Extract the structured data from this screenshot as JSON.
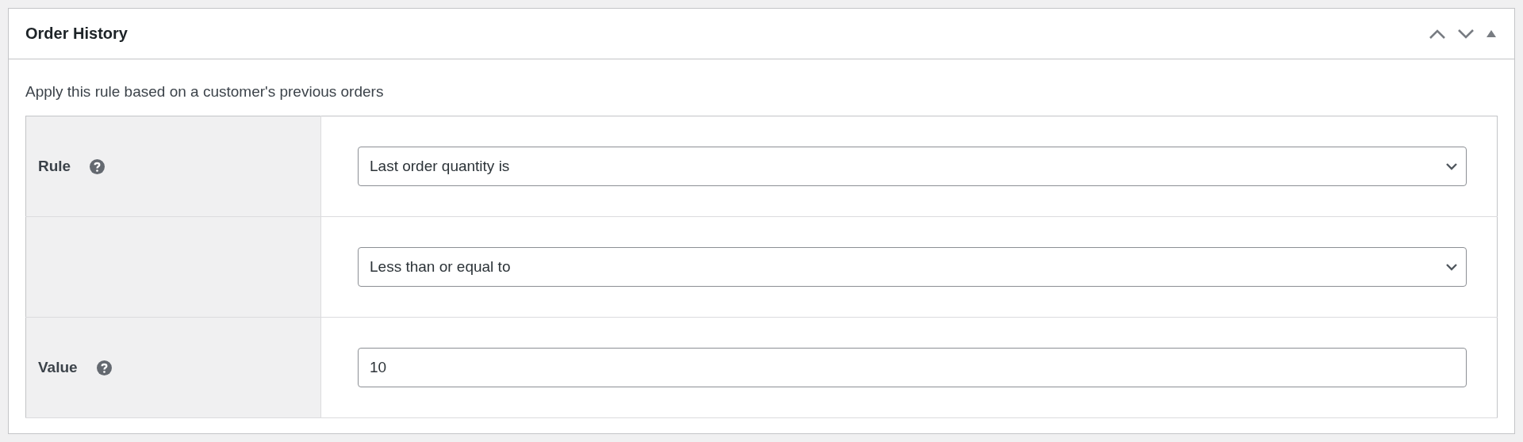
{
  "panel": {
    "title": "Order History",
    "description": "Apply this rule based on a customer's previous orders"
  },
  "rows": [
    {
      "label": "Rule",
      "help": true,
      "kind": "select",
      "value": "Last order quantity is"
    },
    {
      "kind": "select",
      "value": "Less than or equal to"
    },
    {
      "label": "Value",
      "help": true,
      "kind": "text",
      "value": "10"
    }
  ]
}
